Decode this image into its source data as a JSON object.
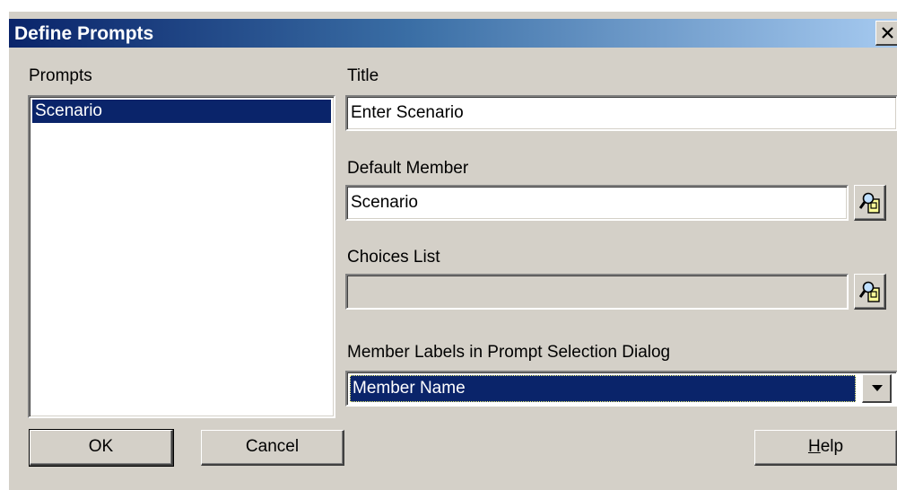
{
  "window": {
    "title": "Define Prompts",
    "close_glyph": "✕"
  },
  "prompts": {
    "label": "Prompts",
    "items": [
      "Scenario"
    ],
    "selected": "Scenario"
  },
  "title_field": {
    "label": "Title",
    "value": "Enter Scenario"
  },
  "default_member": {
    "label": "Default Member",
    "value": "Scenario",
    "browse_icon": "member-selection-icon"
  },
  "choices_list": {
    "label": "Choices List",
    "value": "",
    "browse_icon": "member-selection-icon"
  },
  "member_labels": {
    "label": "Member Labels in Prompt Selection Dialog",
    "selected": "Member Name"
  },
  "buttons": {
    "ok": "OK",
    "cancel": "Cancel",
    "help_prefix": "H",
    "help_rest": "elp"
  },
  "colors": {
    "face": "#d4d0c8",
    "selection": "#0a246a",
    "title_gradient_start": "#0a246a",
    "title_gradient_end": "#a6caf0"
  }
}
